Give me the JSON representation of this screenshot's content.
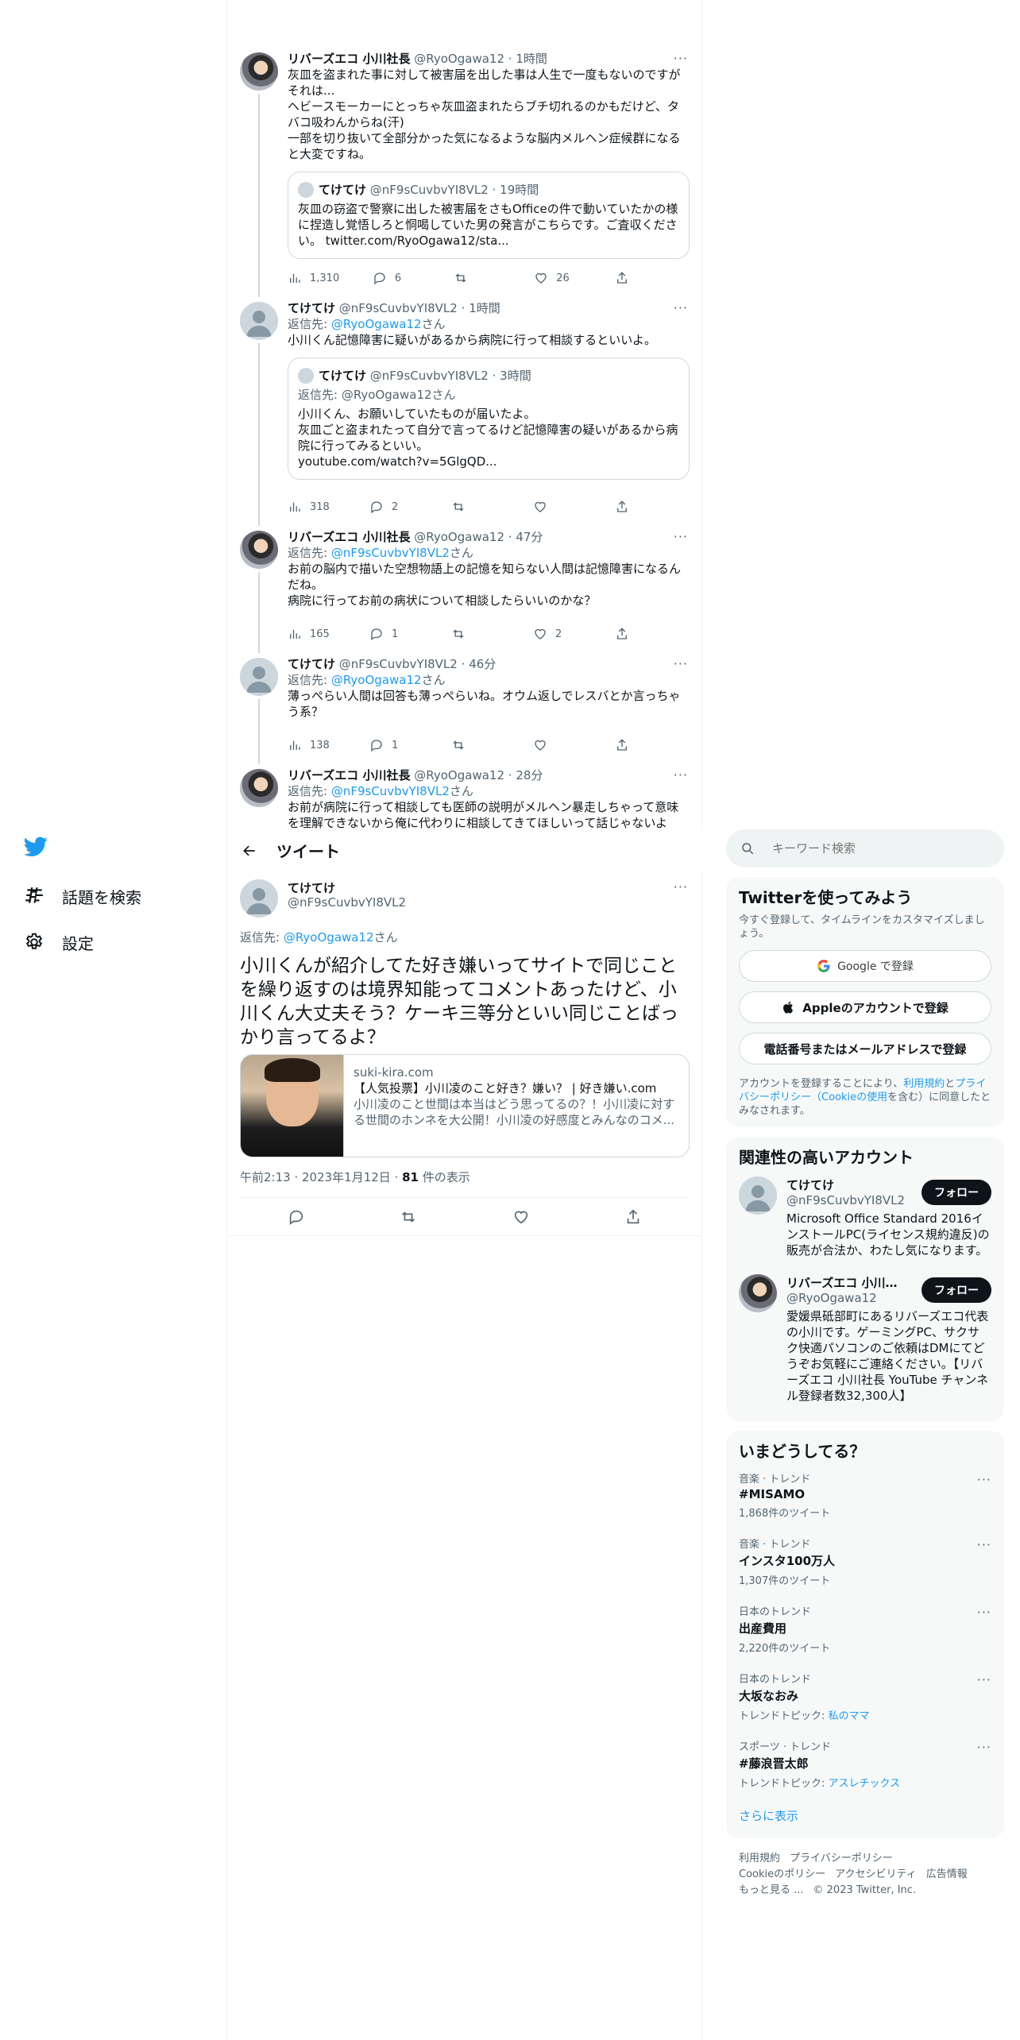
{
  "nav": {
    "search_label": "話題を検索",
    "settings_label": "設定"
  },
  "thread": [
    {
      "name": "リバーズエコ 小川社長",
      "handle": "@RyoOgawa12",
      "time": "1時間",
      "text": "灰皿を盗まれた事に対して被害届を出した事は人生で一度もないのですがそれは...\nヘビースモーカーにとっちゃ灰皿盗まれたらブチ切れるのかもだけど、タバコ吸わんからね(汗)\n一部を切り抜いて全部分かった気になるような脳内メルヘン症候群になると大変ですね。",
      "quote": {
        "name": "てけてけ",
        "handle": "@nF9sCuvbvYI8VL2",
        "time": "19時間",
        "text": "灰皿の窃盗で警察に出した被害届をさもOfficeの件で動いていたかの様に捏造し覚悟しろと恫喝していた男の発言がこちらです。ご査収ください。 twitter.com/RyoOgawa12/sta..."
      },
      "views": "1,310",
      "replies": "6",
      "retweets": "",
      "likes": "26"
    },
    {
      "name": "てけてけ",
      "handle": "@nF9sCuvbvYI8VL2",
      "time": "1時間",
      "reply_prefix": "返信先: ",
      "reply_to": "@RyoOgawa12",
      "reply_suffix": "さん",
      "text": "小川くん記憶障害に疑いがあるから病院に行って相談するといいよ。",
      "quote": {
        "name": "てけてけ",
        "handle": "@nF9sCuvbvYI8VL2",
        "time": "3時間",
        "reply_line": "返信先: @RyoOgawa12さん",
        "text": "小川くん、お願いしていたものが届いたよ。\n灰皿ごと盗まれたって自分で言ってるけど記憶障害の疑いがあるから病院に行ってみるといい。\nyoutube.com/watch?v=5GlgQD..."
      },
      "views": "318",
      "replies": "2",
      "retweets": "",
      "likes": ""
    },
    {
      "name": "リバーズエコ 小川社長",
      "handle": "@RyoOgawa12",
      "time": "47分",
      "reply_prefix": "返信先: ",
      "reply_to": "@nF9sCuvbvYI8VL2",
      "reply_suffix": "さん",
      "text": "お前の脳内で描いた空想物語上の記憶を知らない人間は記憶障害になるんだね。\n病院に行ってお前の病状について相談したらいいのかな？",
      "views": "165",
      "replies": "1",
      "retweets": "",
      "likes": "2"
    },
    {
      "name": "てけてけ",
      "handle": "@nF9sCuvbvYI8VL2",
      "time": "46分",
      "reply_prefix": "返信先: ",
      "reply_to": "@RyoOgawa12",
      "reply_suffix": "さん",
      "text": "薄っぺらい人間は回答も薄っぺらいね。オウム返しでレスバとか言っちゃう系？",
      "views": "138",
      "replies": "1",
      "retweets": "",
      "likes": ""
    },
    {
      "name": "リバーズエコ 小川社長",
      "handle": "@RyoOgawa12",
      "time": "28分",
      "reply_prefix": "返信先: ",
      "reply_to": "@nF9sCuvbvYI8VL2",
      "reply_suffix": "さん",
      "text": "お前が病院に行って相談しても医師の説明がメルヘン暴走しちゃって意味を理解できないから俺に代わりに相談してきてほしいって話じゃないよね？"
    }
  ],
  "header": {
    "title": "ツイート"
  },
  "focal": {
    "name": "てけてけ",
    "handle": "@nF9sCuvbvYI8VL2",
    "reply_prefix": "返信先: ",
    "reply_to": "@RyoOgawa12",
    "reply_suffix": "さん",
    "text": "小川くんが紹介してた好き嫌いってサイトで同じことを繰り返すのは境界知能ってコメントあったけど、小川くん大丈夫そう？ケーキ三等分といい同じことばっかり言ってるよ？",
    "card": {
      "domain": "suki-kira.com",
      "title": "【人気投票】小川凌のこと好き？嫌い？ | 好き嫌い.com",
      "desc": "小川凌のこと世間は本当はどう思ってるの？！小川凌に対する世間のホンネを大公開！小川凌の好感度とみんなのコメ..."
    },
    "time": "午前2:13 · 2023年1月12日 · ",
    "views": "81",
    "views_suffix": " 件の表示"
  },
  "sidebar": {
    "search_placeholder": "キーワード検索",
    "signup": {
      "title": "Twitterを使ってみよう",
      "sub": "今すぐ登録して、タイムラインをカスタマイズしましょう。",
      "google": "Google で登録",
      "apple": "Appleのアカウントで登録",
      "phone": "電話番号またはメールアドレスで登録",
      "terms_1": "アカウントを登録することにより、",
      "terms_tos": "利用規約",
      "terms_2": "と",
      "terms_pp": "プライバシーポリシー（Cookieの使用",
      "terms_3": "を含む）に同意したとみなされます。"
    },
    "related": {
      "title": "関連性の高いアカウント",
      "accounts": [
        {
          "name": "てけてけ",
          "handle": "@nF9sCuvbvYI8VL2",
          "bio": "Microsoft Office Standard 2016インストールPC(ライセンス規約違反)の販売が合法か、わたし気になります。",
          "follow": "フォロー"
        },
        {
          "name": "リバーズエコ 小川社...",
          "handle": "@RyoOgawa12",
          "bio": "愛媛県砥部町にあるリバーズエコ代表の小川です。ゲーミングPC、サクサク快適パソコンのご依頼はDMにてどうぞお気軽にご連絡ください。【リバーズエコ 小川社長 YouTube チャンネル登録者数32,300人】",
          "follow": "フォロー"
        }
      ]
    },
    "trends": {
      "title": "いまどうしてる？",
      "items": [
        {
          "ctx": "音楽 · トレンド",
          "name": "#MISAMO",
          "count": "1,868件のツイート"
        },
        {
          "ctx": "音楽 · トレンド",
          "name": "インスタ100万人",
          "count": "1,307件のツイート"
        },
        {
          "ctx": "日本のトレンド",
          "name": "出産費用",
          "count": "2,220件のツイート"
        },
        {
          "ctx": "日本のトレンド",
          "name": "大坂なおみ",
          "topic_prefix": "トレンドトピック: ",
          "topic": "私のママ"
        },
        {
          "ctx": "スポーツ · トレンド",
          "name": "#藤浪晋太郎",
          "topic_prefix": "トレンドトピック: ",
          "topic": "アスレチックス"
        }
      ],
      "more": "さらに表示"
    },
    "footer": {
      "links": [
        "利用規約",
        "プライバシーポリシー",
        "Cookieのポリシー",
        "アクセシビリティ",
        "広告情報",
        "もっと見る ..."
      ],
      "copyright": "© 2023 Twitter, Inc."
    }
  }
}
